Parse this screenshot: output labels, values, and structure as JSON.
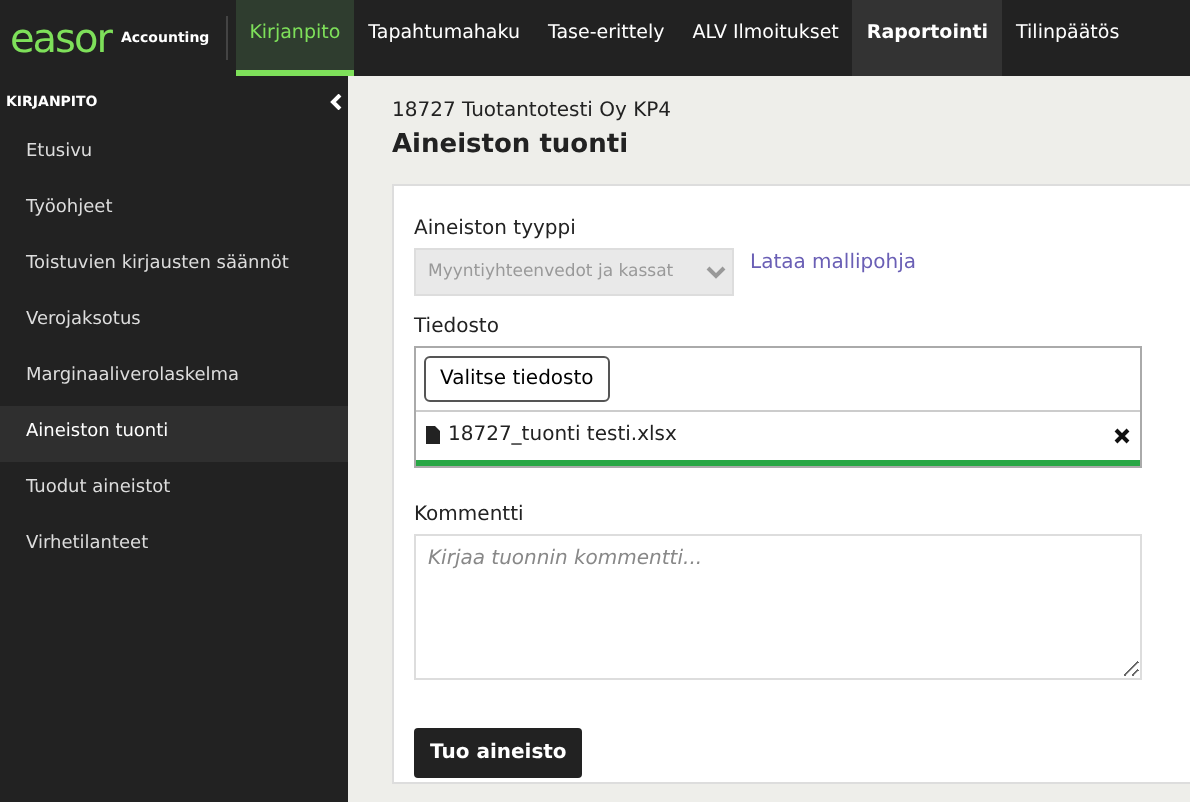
{
  "brand": {
    "logo": "easor",
    "product": "Accounting"
  },
  "nav_tabs": [
    {
      "label": "Kirjanpito",
      "selected": true,
      "hovered": false
    },
    {
      "label": "Tapahtumahaku",
      "selected": false,
      "hovered": false
    },
    {
      "label": "Tase-erittely",
      "selected": false,
      "hovered": false
    },
    {
      "label": "ALV Ilmoitukset",
      "selected": false,
      "hovered": false
    },
    {
      "label": "Raportointi",
      "selected": false,
      "hovered": true
    },
    {
      "label": "Tilinpäätös",
      "selected": false,
      "hovered": false
    }
  ],
  "sidebar": {
    "title": "KIRJANPITO",
    "items": [
      {
        "label": "Etusivu",
        "selected": false
      },
      {
        "label": "Työohjeet",
        "selected": false
      },
      {
        "label": "Toistuvien kirjausten säännöt",
        "selected": false
      },
      {
        "label": "Verojaksotus",
        "selected": false
      },
      {
        "label": "Marginaaliverolaskelma",
        "selected": false
      },
      {
        "label": "Aineiston tuonti",
        "selected": true
      },
      {
        "label": "Tuodut aineistot",
        "selected": false
      },
      {
        "label": "Virhetilanteet",
        "selected": false
      }
    ]
  },
  "page": {
    "company": "18727 Tuotantotesti Oy KP4",
    "title": "Aineiston tuonti"
  },
  "form": {
    "type_label": "Aineiston tyyppi",
    "type_value": "Myyntiyhteenvedot ja kassat",
    "type_disabled": true,
    "template_link": "Lataa mallipohja",
    "file_label": "Tiedosto",
    "choose_button": "Valitse tiedosto",
    "file_name": "18727_tuonti testi.xlsx",
    "upload": {
      "level": 1
    },
    "comment_label": "Kommentti",
    "comment_placeholder": "Kirjaa tuonnin kommentti...",
    "submit_button": "Tuo aineisto"
  }
}
